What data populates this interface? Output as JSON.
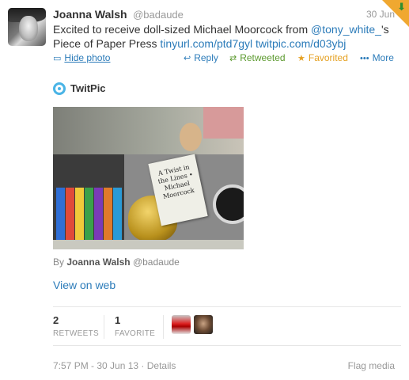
{
  "tweet": {
    "author_name": "Joanna Walsh",
    "author_handle": "@badaude",
    "date": "30 Jun",
    "text_pre": "Excited to receive doll-sized Michael Moorcock from ",
    "mention": "@tony_white_",
    "text_mid": "'s Piece of Paper Press ",
    "link1": "tinyurl.com/ptd7gyl",
    "link2": "twitpic.com/d03ybj"
  },
  "actions": {
    "hide_photo": "Hide photo",
    "reply": "Reply",
    "retweeted": "Retweeted",
    "favorited": "Favorited",
    "more": "More"
  },
  "media": {
    "provider": "TwitPic",
    "book_text": "A Twist in the Lines • Michael Moorcock",
    "by_prefix": "By",
    "by_name": "Joanna Walsh",
    "by_handle": "@badaude",
    "view_on_web": "View on web"
  },
  "stats": {
    "retweets_count": "2",
    "retweets_label": "RETWEETS",
    "favorites_count": "1",
    "favorites_label": "FAVORITE"
  },
  "footer": {
    "timestamp": "7:57 PM - 30 Jun 13",
    "separator": " · ",
    "details": "Details",
    "flag_media": "Flag media"
  },
  "icons": {
    "hide_photo": "photo-icon",
    "reply": "reply-icon",
    "retweeted": "retweet-icon",
    "favorited": "star-icon",
    "more": "more-dots-icon",
    "provider": "twitpic-icon"
  },
  "colors": {
    "link": "#2b7bb9",
    "retweeted": "#5c9a2f",
    "favorited": "#e5a123",
    "muted": "#999999"
  }
}
